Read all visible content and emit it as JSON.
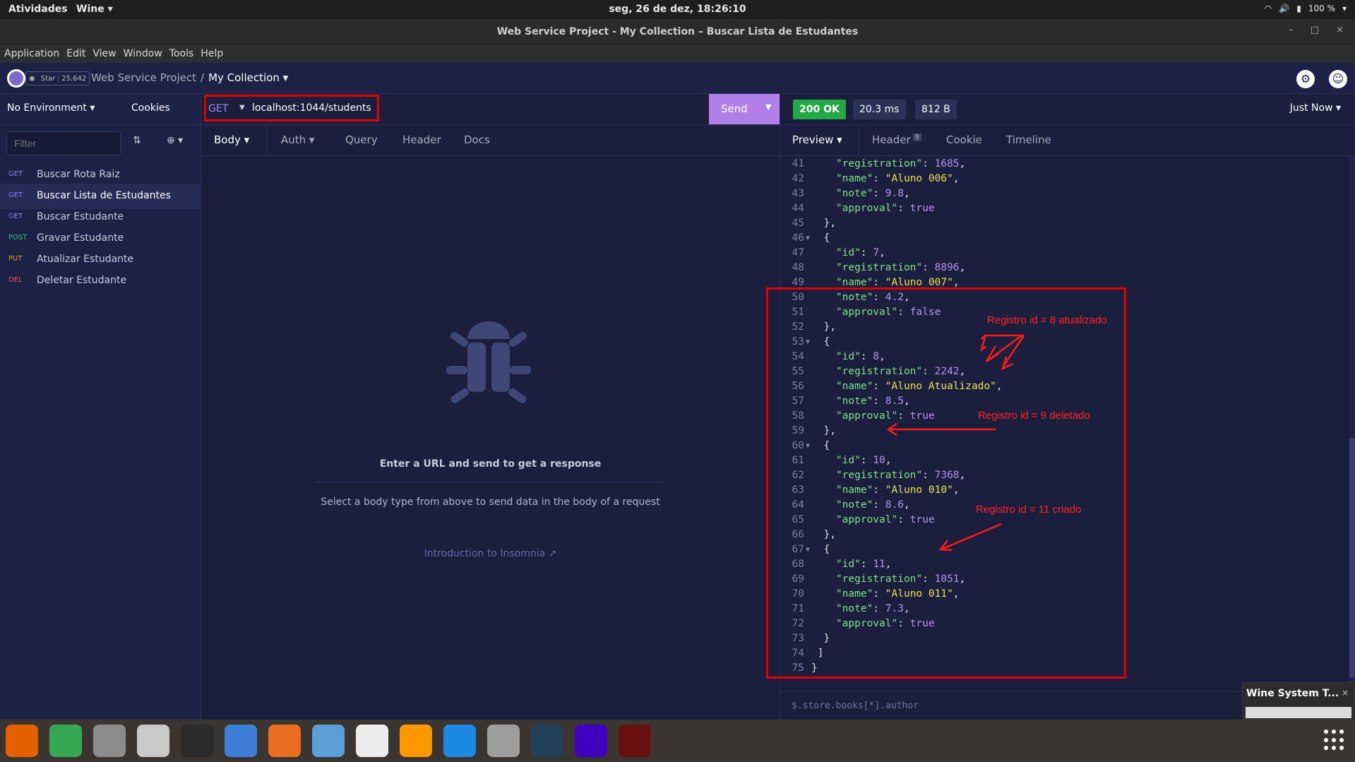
{
  "gnome": {
    "activities": "Atividades",
    "app": "Wine ▾",
    "clock": "seg, 26 de dez, 18:26:10",
    "battery": "100 %"
  },
  "window": {
    "title": "Web Service Project - My Collection – Buscar Lista de Estudantes"
  },
  "menu": [
    "Application",
    "Edit",
    "View",
    "Window",
    "Tools",
    "Help"
  ],
  "header": {
    "star_label": "Star",
    "star_count": "25,642",
    "project": "Web Service Project",
    "separator": "/",
    "collection": "My Collection ▾"
  },
  "sidebar": {
    "environment": "No Environment ▾",
    "cookies": "Cookies",
    "filter_placeholder": "Filter",
    "requests": [
      {
        "method": "GET",
        "name": "Buscar Rota Raiz",
        "color": "#8f7ff0"
      },
      {
        "method": "GET",
        "name": "Buscar Lista de Estudantes",
        "color": "#8f7ff0"
      },
      {
        "method": "GET",
        "name": "Buscar Estudante",
        "color": "#8f7ff0"
      },
      {
        "method": "POST",
        "name": "Gravar Estudante",
        "color": "#3ec18a"
      },
      {
        "method": "PUT",
        "name": "Atualizar Estudante",
        "color": "#e39a3b"
      },
      {
        "method": "DEL",
        "name": "Deletar Estudante",
        "color": "#e45a5a"
      }
    ]
  },
  "request": {
    "method": "GET",
    "url": "localhost:1044/students",
    "send": "Send",
    "tabs": [
      "Body ▾",
      "Auth ▾",
      "Query",
      "Header",
      "Docs"
    ],
    "empty_title": "Enter a URL and send to get a response",
    "empty_subtitle": "Select a body type from above to send data in the body of a request",
    "intro_link": "Introduction to Insomnia ↗"
  },
  "response": {
    "status": "200 OK",
    "time": "20.3 ms",
    "size": "812 B",
    "timestamp": "Just Now ▾",
    "tabs": [
      "Preview ▾",
      "Header",
      "Cookie",
      "Timeline"
    ],
    "header_count": "8",
    "filter_placeholder": "$.store.books[*].author"
  },
  "code_lines": [
    {
      "n": "41",
      "t": [
        [
          "k",
          "    \"registration\""
        ],
        [
          "p",
          ": "
        ],
        [
          "nm",
          "1685"
        ],
        [
          "p",
          ","
        ]
      ]
    },
    {
      "n": "42",
      "t": [
        [
          "k",
          "    \"name\""
        ],
        [
          "p",
          ": "
        ],
        [
          "s",
          "\"Aluno 006\""
        ],
        [
          "p",
          ","
        ]
      ]
    },
    {
      "n": "43",
      "t": [
        [
          "k",
          "    \"note\""
        ],
        [
          "p",
          ": "
        ],
        [
          "nm",
          "9.8"
        ],
        [
          "p",
          ","
        ]
      ]
    },
    {
      "n": "44",
      "t": [
        [
          "k",
          "    \"approval\""
        ],
        [
          "p",
          ": "
        ],
        [
          "nm",
          "true"
        ]
      ]
    },
    {
      "n": "45",
      "t": [
        [
          "p",
          "  },"
        ]
      ]
    },
    {
      "n": "46",
      "fold": true,
      "t": [
        [
          "p",
          "  {"
        ]
      ]
    },
    {
      "n": "47",
      "t": [
        [
          "k",
          "    \"id\""
        ],
        [
          "p",
          ": "
        ],
        [
          "nm",
          "7"
        ],
        [
          "p",
          ","
        ]
      ]
    },
    {
      "n": "48",
      "t": [
        [
          "k",
          "    \"registration\""
        ],
        [
          "p",
          ": "
        ],
        [
          "nm",
          "8896"
        ],
        [
          "p",
          ","
        ]
      ]
    },
    {
      "n": "49",
      "t": [
        [
          "k",
          "    \"name\""
        ],
        [
          "p",
          ": "
        ],
        [
          "s",
          "\"Aluno 007\""
        ],
        [
          "p",
          ","
        ]
      ]
    },
    {
      "n": "50",
      "t": [
        [
          "k",
          "    \"note\""
        ],
        [
          "p",
          ": "
        ],
        [
          "nm",
          "4.2"
        ],
        [
          "p",
          ","
        ]
      ]
    },
    {
      "n": "51",
      "t": [
        [
          "k",
          "    \"approval\""
        ],
        [
          "p",
          ": "
        ],
        [
          "nm",
          "false"
        ]
      ]
    },
    {
      "n": "52",
      "t": [
        [
          "p",
          "  },"
        ]
      ]
    },
    {
      "n": "53",
      "fold": true,
      "t": [
        [
          "p",
          "  {"
        ]
      ]
    },
    {
      "n": "54",
      "t": [
        [
          "k",
          "    \"id\""
        ],
        [
          "p",
          ": "
        ],
        [
          "nm",
          "8"
        ],
        [
          "p",
          ","
        ]
      ]
    },
    {
      "n": "55",
      "t": [
        [
          "k",
          "    \"registration\""
        ],
        [
          "p",
          ": "
        ],
        [
          "nm",
          "2242"
        ],
        [
          "p",
          ","
        ]
      ]
    },
    {
      "n": "56",
      "t": [
        [
          "k",
          "    \"name\""
        ],
        [
          "p",
          ": "
        ],
        [
          "s",
          "\"Aluno Atualizado\""
        ],
        [
          "p",
          ","
        ]
      ]
    },
    {
      "n": "57",
      "t": [
        [
          "k",
          "    \"note\""
        ],
        [
          "p",
          ": "
        ],
        [
          "nm",
          "8.5"
        ],
        [
          "p",
          ","
        ]
      ]
    },
    {
      "n": "58",
      "t": [
        [
          "k",
          "    \"approval\""
        ],
        [
          "p",
          ": "
        ],
        [
          "nm",
          "true"
        ]
      ]
    },
    {
      "n": "59",
      "t": [
        [
          "p",
          "  },"
        ]
      ]
    },
    {
      "n": "60",
      "fold": true,
      "t": [
        [
          "p",
          "  {"
        ]
      ]
    },
    {
      "n": "61",
      "t": [
        [
          "k",
          "    \"id\""
        ],
        [
          "p",
          ": "
        ],
        [
          "nm",
          "10"
        ],
        [
          "p",
          ","
        ]
      ]
    },
    {
      "n": "62",
      "t": [
        [
          "k",
          "    \"registration\""
        ],
        [
          "p",
          ": "
        ],
        [
          "nm",
          "7368"
        ],
        [
          "p",
          ","
        ]
      ]
    },
    {
      "n": "63",
      "t": [
        [
          "k",
          "    \"name\""
        ],
        [
          "p",
          ": "
        ],
        [
          "s",
          "\"Aluno 010\""
        ],
        [
          "p",
          ","
        ]
      ]
    },
    {
      "n": "64",
      "t": [
        [
          "k",
          "    \"note\""
        ],
        [
          "p",
          ": "
        ],
        [
          "nm",
          "8.6"
        ],
        [
          "p",
          ","
        ]
      ]
    },
    {
      "n": "65",
      "t": [
        [
          "k",
          "    \"approval\""
        ],
        [
          "p",
          ": "
        ],
        [
          "nm",
          "true"
        ]
      ]
    },
    {
      "n": "66",
      "t": [
        [
          "p",
          "  },"
        ]
      ]
    },
    {
      "n": "67",
      "fold": true,
      "t": [
        [
          "p",
          "  {"
        ]
      ]
    },
    {
      "n": "68",
      "t": [
        [
          "k",
          "    \"id\""
        ],
        [
          "p",
          ": "
        ],
        [
          "nm",
          "11"
        ],
        [
          "p",
          ","
        ]
      ]
    },
    {
      "n": "69",
      "t": [
        [
          "k",
          "    \"registration\""
        ],
        [
          "p",
          ": "
        ],
        [
          "nm",
          "1051"
        ],
        [
          "p",
          ","
        ]
      ]
    },
    {
      "n": "70",
      "t": [
        [
          "k",
          "    \"name\""
        ],
        [
          "p",
          ": "
        ],
        [
          "s",
          "\"Aluno 011\""
        ],
        [
          "p",
          ","
        ]
      ]
    },
    {
      "n": "71",
      "t": [
        [
          "k",
          "    \"note\""
        ],
        [
          "p",
          ": "
        ],
        [
          "nm",
          "7.3"
        ],
        [
          "p",
          ","
        ]
      ]
    },
    {
      "n": "72",
      "t": [
        [
          "k",
          "    \"approval\""
        ],
        [
          "p",
          ": "
        ],
        [
          "nm",
          "true"
        ]
      ]
    },
    {
      "n": "73",
      "t": [
        [
          "p",
          "  }"
        ]
      ]
    },
    {
      "n": "74",
      "t": [
        [
          "p",
          " ]"
        ]
      ]
    },
    {
      "n": "75",
      "t": [
        [
          "p",
          "}"
        ]
      ]
    }
  ],
  "annotations": {
    "updated": "Registro id = 8 atualizado",
    "deleted": "Registro id = 9 deletado",
    "created": "Registro id = 11 criado"
  },
  "wine_notification": {
    "title": "Wine System T..."
  },
  "dock": [
    {
      "icon": "firefox-icon",
      "color": "#e66000"
    },
    {
      "icon": "chrome-icon",
      "color": "#34a853"
    },
    {
      "icon": "files-icon",
      "color": "#8c8c8c"
    },
    {
      "icon": "rhythmbox-icon",
      "color": "#c9c9c9"
    },
    {
      "icon": "terminal-icon",
      "color": "#2b2b2b"
    },
    {
      "icon": "help-icon",
      "color": "#3d7fd8"
    },
    {
      "icon": "software-icon",
      "color": "#e96e1f"
    },
    {
      "icon": "image-viewer-icon",
      "color": "#5c9ed8"
    },
    {
      "icon": "evince-icon",
      "color": "#ececec"
    },
    {
      "icon": "sublime-icon",
      "color": "#ff9800"
    },
    {
      "icon": "vscode-icon",
      "color": "#1e88e5"
    },
    {
      "icon": "database-icon",
      "color": "#9e9e9e"
    },
    {
      "icon": "mysql-workbench-icon",
      "color": "#21415a"
    },
    {
      "icon": "insomnia-icon",
      "color": "#4000bf"
    },
    {
      "icon": "wine-icon",
      "color": "#6a0f0f"
    }
  ]
}
